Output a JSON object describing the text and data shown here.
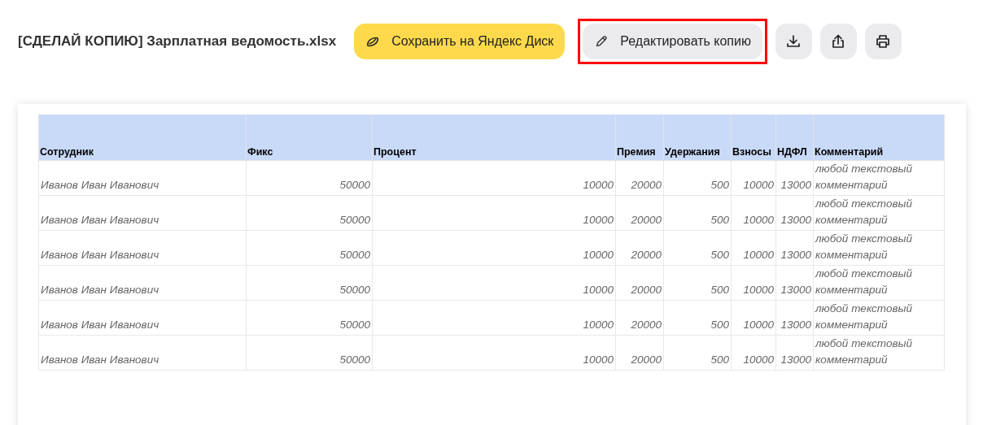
{
  "title": "[СДЕЛАЙ КОПИЮ] Зарплатная ведомость.xlsx",
  "actions": [
    {
      "kind": "save",
      "label": "Сохранить на Яндекс Диск",
      "highlighted": false
    },
    {
      "kind": "edit",
      "label": "Редактировать копию",
      "highlighted": true
    },
    {
      "kind": "download"
    },
    {
      "kind": "share"
    },
    {
      "kind": "print"
    }
  ],
  "table": {
    "columns": [
      "Сотрудник",
      "Фикс",
      "Процент",
      "Премия",
      "Удержания",
      "Взносы",
      "НДФЛ",
      "Комментарий"
    ],
    "rows": [
      [
        "Иванов Иван Иванович",
        "50000",
        "10000",
        "20000",
        "500",
        "10000",
        "13000",
        "любой текстовый комментарий"
      ],
      [
        "Иванов Иван Иванович",
        "50000",
        "10000",
        "20000",
        "500",
        "10000",
        "13000",
        "любой текстовый комментарий"
      ],
      [
        "Иванов Иван Иванович",
        "50000",
        "10000",
        "20000",
        "500",
        "10000",
        "13000",
        "любой текстовый комментарий"
      ],
      [
        "Иванов Иван Иванович",
        "50000",
        "10000",
        "20000",
        "500",
        "10000",
        "13000",
        "любой текстовый комментарий"
      ],
      [
        "Иванов Иван Иванович",
        "50000",
        "10000",
        "20000",
        "500",
        "10000",
        "13000",
        "любой текстовый комментарий"
      ],
      [
        "Иванов Иван Иванович",
        "50000",
        "10000",
        "20000",
        "500",
        "10000",
        "13000",
        "любой текстовый комментарий"
      ]
    ]
  }
}
